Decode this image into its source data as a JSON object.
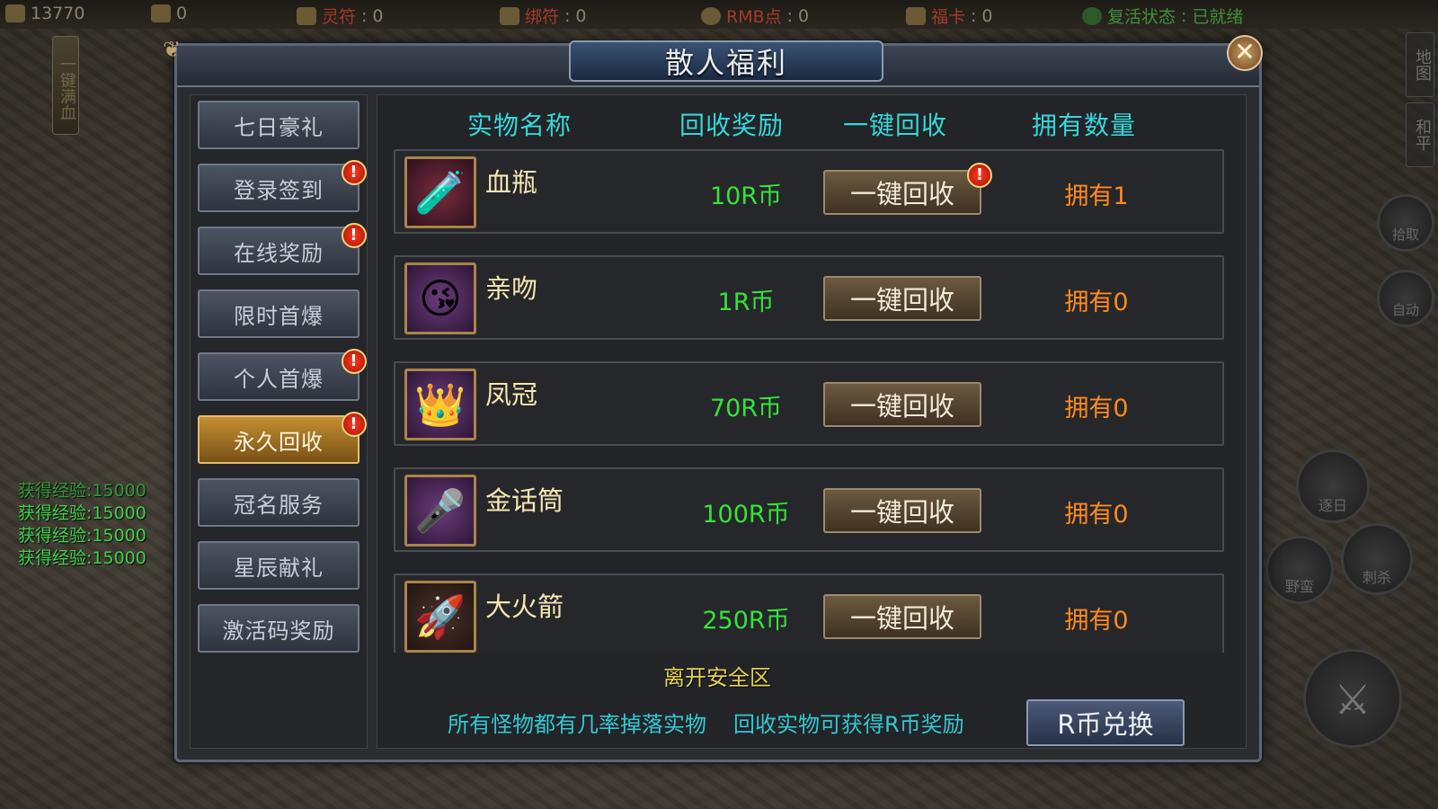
{
  "hud": {
    "gold": "13770",
    "ingot": "0",
    "lingfu_label": "灵符",
    "lingfu": "0",
    "bangfu_label": "绑符",
    "bangfu": "0",
    "rmb_label": "RMB点",
    "rmb": "0",
    "fuka_label": "福卡",
    "fuka": "0",
    "revive_label": "复活状态",
    "revive_status": "已就绪"
  },
  "side_tab": "一键满血",
  "exp_log": [
    "获得经验:15000",
    "获得经验:15000",
    "获得经验:15000",
    "获得经验:15000"
  ],
  "right_hud": {
    "map_label": "地图",
    "peace_label": "和平",
    "pickup_label": "拾取",
    "auto_label": "自动",
    "skills": [
      "逐日",
      "野蛮",
      "刺杀"
    ]
  },
  "dialog": {
    "title": "散人福利",
    "close_glyph": "✕"
  },
  "nav": {
    "items": [
      {
        "label": "七日豪礼",
        "badge": false,
        "active": false
      },
      {
        "label": "登录签到",
        "badge": true,
        "active": false
      },
      {
        "label": "在线奖励",
        "badge": true,
        "active": false
      },
      {
        "label": "限时首爆",
        "badge": false,
        "active": false
      },
      {
        "label": "个人首爆",
        "badge": true,
        "active": false
      },
      {
        "label": "永久回收",
        "badge": true,
        "active": true
      },
      {
        "label": "冠名服务",
        "badge": false,
        "active": false
      },
      {
        "label": "星辰献礼",
        "badge": false,
        "active": false
      },
      {
        "label": "激活码奖励",
        "badge": false,
        "active": false
      }
    ],
    "badge_glyph": "!"
  },
  "table": {
    "headers": [
      "实物名称",
      "回收奖励",
      "一键回收",
      "拥有数量"
    ],
    "rows": [
      {
        "name": "血瓶",
        "icon": "blood-bottle-icon",
        "glyph": "🧪",
        "reward": "10R币",
        "button": "一键回收",
        "button_badge": true,
        "owned": "拥有1"
      },
      {
        "name": "亲吻",
        "icon": "kiss-emoji-icon",
        "glyph": "😘",
        "reward": "1R币",
        "button": "一键回收",
        "button_badge": false,
        "owned": "拥有0"
      },
      {
        "name": "凤冠",
        "icon": "phoenix-crown-icon",
        "glyph": "👑",
        "reward": "70R币",
        "button": "一键回收",
        "button_badge": false,
        "owned": "拥有0"
      },
      {
        "name": "金话筒",
        "icon": "gold-microphone-icon",
        "glyph": "🎤",
        "reward": "100R币",
        "button": "一键回收",
        "button_badge": false,
        "owned": "拥有0"
      },
      {
        "name": "大火箭",
        "icon": "big-rocket-icon",
        "glyph": "🚀",
        "reward": "250R币",
        "button": "一键回收",
        "button_badge": false,
        "owned": "拥有0"
      }
    ]
  },
  "overlay_msg": "离开安全区",
  "footer": {
    "note1": "所有怪物都有几率掉落实物",
    "note2": "回收实物可获得R币奖励",
    "exchange_button": "R币兑换"
  },
  "colors": {
    "header_cyan": "#35d7d9",
    "reward_green": "#35e23a",
    "owned_orange": "#ff8a1f",
    "active_tab_gold": "#c38f32"
  }
}
